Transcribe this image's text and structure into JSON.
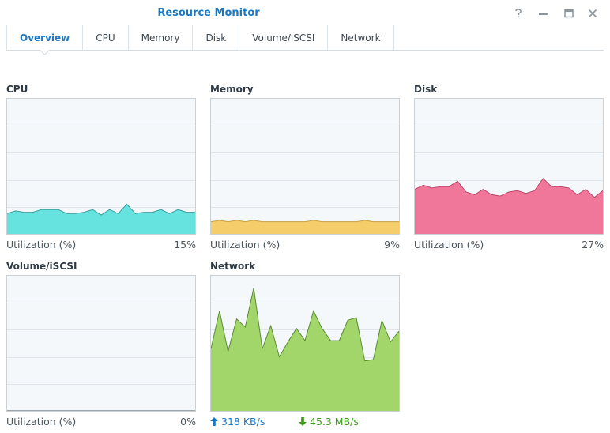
{
  "window": {
    "title": "Resource Monitor"
  },
  "tabs": [
    {
      "label": "Overview",
      "active": true
    },
    {
      "label": "CPU",
      "active": false
    },
    {
      "label": "Memory",
      "active": false
    },
    {
      "label": "Disk",
      "active": false
    },
    {
      "label": "Volume/iSCSI",
      "active": false
    },
    {
      "label": "Network",
      "active": false
    }
  ],
  "window_controls": [
    "help-icon",
    "minimize-icon",
    "maximize-icon",
    "close-icon"
  ],
  "panels": {
    "cpu": {
      "title": "CPU",
      "footer_label": "Utilization (%)",
      "footer_value": "15%",
      "fill_color": "#66e3df",
      "stroke_color": "#3a9f9c",
      "ylim": [
        0,
        100
      ],
      "values": [
        15,
        17,
        16,
        16,
        18,
        18,
        18,
        15,
        15,
        16,
        18,
        14,
        18,
        15,
        22,
        15,
        16,
        16,
        18,
        15,
        18,
        16,
        16
      ]
    },
    "memory": {
      "title": "Memory",
      "footer_label": "Utilization (%)",
      "footer_value": "9%",
      "fill_color": "#f5cd6a",
      "stroke_color": "#c9a043",
      "ylim": [
        0,
        100
      ],
      "values": [
        9,
        10,
        9,
        10,
        9,
        10,
        9,
        9,
        9,
        9,
        9,
        9,
        10,
        9,
        9,
        9,
        9,
        9,
        10,
        9,
        9,
        9,
        9
      ]
    },
    "disk": {
      "title": "Disk",
      "footer_label": "Utilization (%)",
      "footer_value": "27%",
      "fill_color": "#f0779a",
      "stroke_color": "#b9486a",
      "ylim": [
        0,
        100
      ],
      "values": [
        33,
        36,
        34,
        35,
        35,
        39,
        31,
        29,
        33,
        29,
        28,
        31,
        32,
        30,
        32,
        41,
        35,
        35,
        34,
        29,
        33,
        27,
        32
      ]
    },
    "volume": {
      "title": "Volume/iSCSI",
      "footer_label": "Utilization (%)",
      "footer_value": "0%",
      "fill_color": "#9aa6ae",
      "stroke_color": "#9aa6ae",
      "ylim": [
        0,
        100
      ],
      "values": [
        0,
        0,
        0,
        0,
        0,
        0,
        0,
        0,
        0,
        0,
        0,
        0,
        0,
        0,
        0,
        0,
        0,
        0,
        0,
        0,
        0,
        0,
        0
      ]
    },
    "network": {
      "title": "Network",
      "fill_color": "#a3d66a",
      "stroke_color": "#5a8a35",
      "upload": "318 KB/s",
      "download": "45.3 MB/s",
      "ylim": [
        0,
        100
      ],
      "values": [
        46,
        74,
        44,
        68,
        62,
        91,
        46,
        63,
        40,
        51,
        61,
        52,
        74,
        61,
        52,
        52,
        67,
        69,
        37,
        38,
        67,
        51,
        59
      ]
    }
  },
  "chart_data": [
    {
      "type": "area",
      "title": "CPU",
      "ylabel": "Utilization (%)",
      "ylim": [
        0,
        100
      ],
      "series": [
        {
          "values": [
            15,
            17,
            16,
            16,
            18,
            18,
            18,
            15,
            15,
            16,
            18,
            14,
            18,
            15,
            22,
            15,
            16,
            16,
            18,
            15,
            18,
            16,
            16
          ]
        }
      ]
    },
    {
      "type": "area",
      "title": "Memory",
      "ylabel": "Utilization (%)",
      "ylim": [
        0,
        100
      ],
      "series": [
        {
          "values": [
            9,
            10,
            9,
            10,
            9,
            10,
            9,
            9,
            9,
            9,
            9,
            9,
            10,
            9,
            9,
            9,
            9,
            9,
            10,
            9,
            9,
            9,
            9
          ]
        }
      ]
    },
    {
      "type": "area",
      "title": "Disk",
      "ylabel": "Utilization (%)",
      "ylim": [
        0,
        100
      ],
      "series": [
        {
          "values": [
            33,
            36,
            34,
            35,
            35,
            39,
            31,
            29,
            33,
            29,
            28,
            31,
            32,
            30,
            32,
            41,
            35,
            35,
            34,
            29,
            33,
            27,
            32
          ]
        }
      ]
    },
    {
      "type": "area",
      "title": "Volume/iSCSI",
      "ylabel": "Utilization (%)",
      "ylim": [
        0,
        100
      ],
      "series": [
        {
          "values": [
            0,
            0,
            0,
            0,
            0,
            0,
            0,
            0,
            0,
            0,
            0,
            0,
            0,
            0,
            0,
            0,
            0,
            0,
            0,
            0,
            0,
            0,
            0
          ]
        }
      ]
    },
    {
      "type": "area",
      "title": "Network",
      "ylim": [
        0,
        100
      ],
      "series": [
        {
          "values": [
            46,
            74,
            44,
            68,
            62,
            91,
            46,
            63,
            40,
            51,
            61,
            52,
            74,
            61,
            52,
            52,
            67,
            69,
            37,
            38,
            67,
            51,
            59
          ]
        }
      ]
    }
  ]
}
